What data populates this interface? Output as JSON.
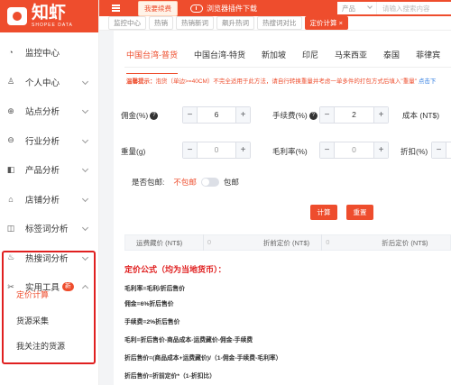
{
  "brand": {
    "name": "知虾",
    "sub": "SHOPEE DATA"
  },
  "topbar": {
    "vip_label": "我要续费",
    "plugin_label": "浏览器插件下载",
    "search_scope": "产品",
    "search_placeholder": "请输入搜索内容"
  },
  "breadcrumbs": [
    "监控中心",
    "热销",
    "热销新词",
    "飙升热词",
    "热搜词对比",
    "定价计算"
  ],
  "sidebar": {
    "items": [
      {
        "label": "监控中心",
        "icon": "dashboard-icon"
      },
      {
        "label": "个人中心",
        "icon": "user-icon"
      },
      {
        "label": "站点分析",
        "icon": "site-icon"
      },
      {
        "label": "行业分析",
        "icon": "industry-icon"
      },
      {
        "label": "产品分析",
        "icon": "product-icon"
      },
      {
        "label": "店铺分析",
        "icon": "shop-icon"
      },
      {
        "label": "标签词分析",
        "icon": "tag-icon"
      },
      {
        "label": "热搜词分析",
        "icon": "fire-icon"
      },
      {
        "label": "实用工具",
        "icon": "tools-icon",
        "badge": "新"
      }
    ],
    "tools_sub": [
      "定价计算",
      "货源采集",
      "我关注的货源"
    ]
  },
  "main": {
    "country_tabs": [
      "中国台湾-普货",
      "中国台湾-特货",
      "新加坡",
      "印尼",
      "马来西亚",
      "泰国",
      "菲律宾"
    ],
    "notice_prefix": "温馨提示：",
    "notice_text": "泡货（单边>=40CM）不完全适用于此方法，请自行转换重量并考虑一单多件的打包方式后填入\"重量\"",
    "notice_link": "点击下",
    "fields": {
      "commission_label": "佣金(%)",
      "commission_value": "6",
      "fee_label": "手续费(%)",
      "fee_value": "2",
      "cost_label": "成本 (NT$)",
      "weight_label": "重量(g)",
      "weight_value": "0",
      "margin_label": "毛利率(%)",
      "margin_value": "0",
      "discount_label": "折扣(%)"
    },
    "shipping_label": "是否包邮:",
    "shipping_no": "不包邮",
    "shipping_yes": "包邮",
    "btn_calc": "计算",
    "btn_reset": "重置",
    "result": {
      "freight_label": "运费藏价 (NT$)",
      "freight_value": "0",
      "pre_discount_label": "折前定价 (NT$)",
      "pre_discount_value": "0",
      "post_discount_label": "折后定价 (NT$)"
    },
    "formula_title": "定价公式（均为当地货币）：",
    "formulas": [
      "毛利率=毛利/折后售价",
      "佣金=6%折后售价",
      "手续费=2%折后售价",
      "毛利=折后售价-商品成本-运费藏价-佣金-手续费",
      "折后售价=(商品成本+运费藏价)/（1-佣金-手续费-毛利率）",
      "折后售价=折前定价*（1-折扣比）"
    ]
  }
}
